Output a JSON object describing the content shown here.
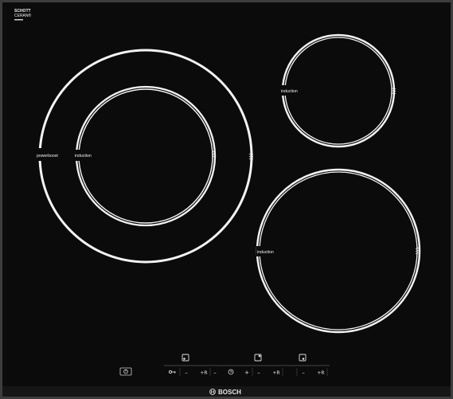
{
  "brand": {
    "glass_logo_line1": "SCHOTT",
    "glass_logo_line2": "CERAN®",
    "maker_logo": "BOSCH"
  },
  "zones": {
    "large_outer_label": "powerboost",
    "large_inner_label": "induction",
    "small_top_label": "induction",
    "medium_right_label": "induction"
  },
  "controls": {
    "minus_symbol": "–",
    "plus_symbol": "+",
    "boost_symbol": "+R",
    "power_icon": "power-icon",
    "childlock_icon": "key-lock-icon",
    "timer_icon": "clock-timer-icon",
    "zone_indicator_icons": [
      "zone-front-left-icon",
      "zone-back-right-icon",
      "zone-front-right-icon"
    ]
  },
  "colors": {
    "glass": "#0b0b0b",
    "frame": "#3a3a3a",
    "ring": "#f4f4f4"
  }
}
